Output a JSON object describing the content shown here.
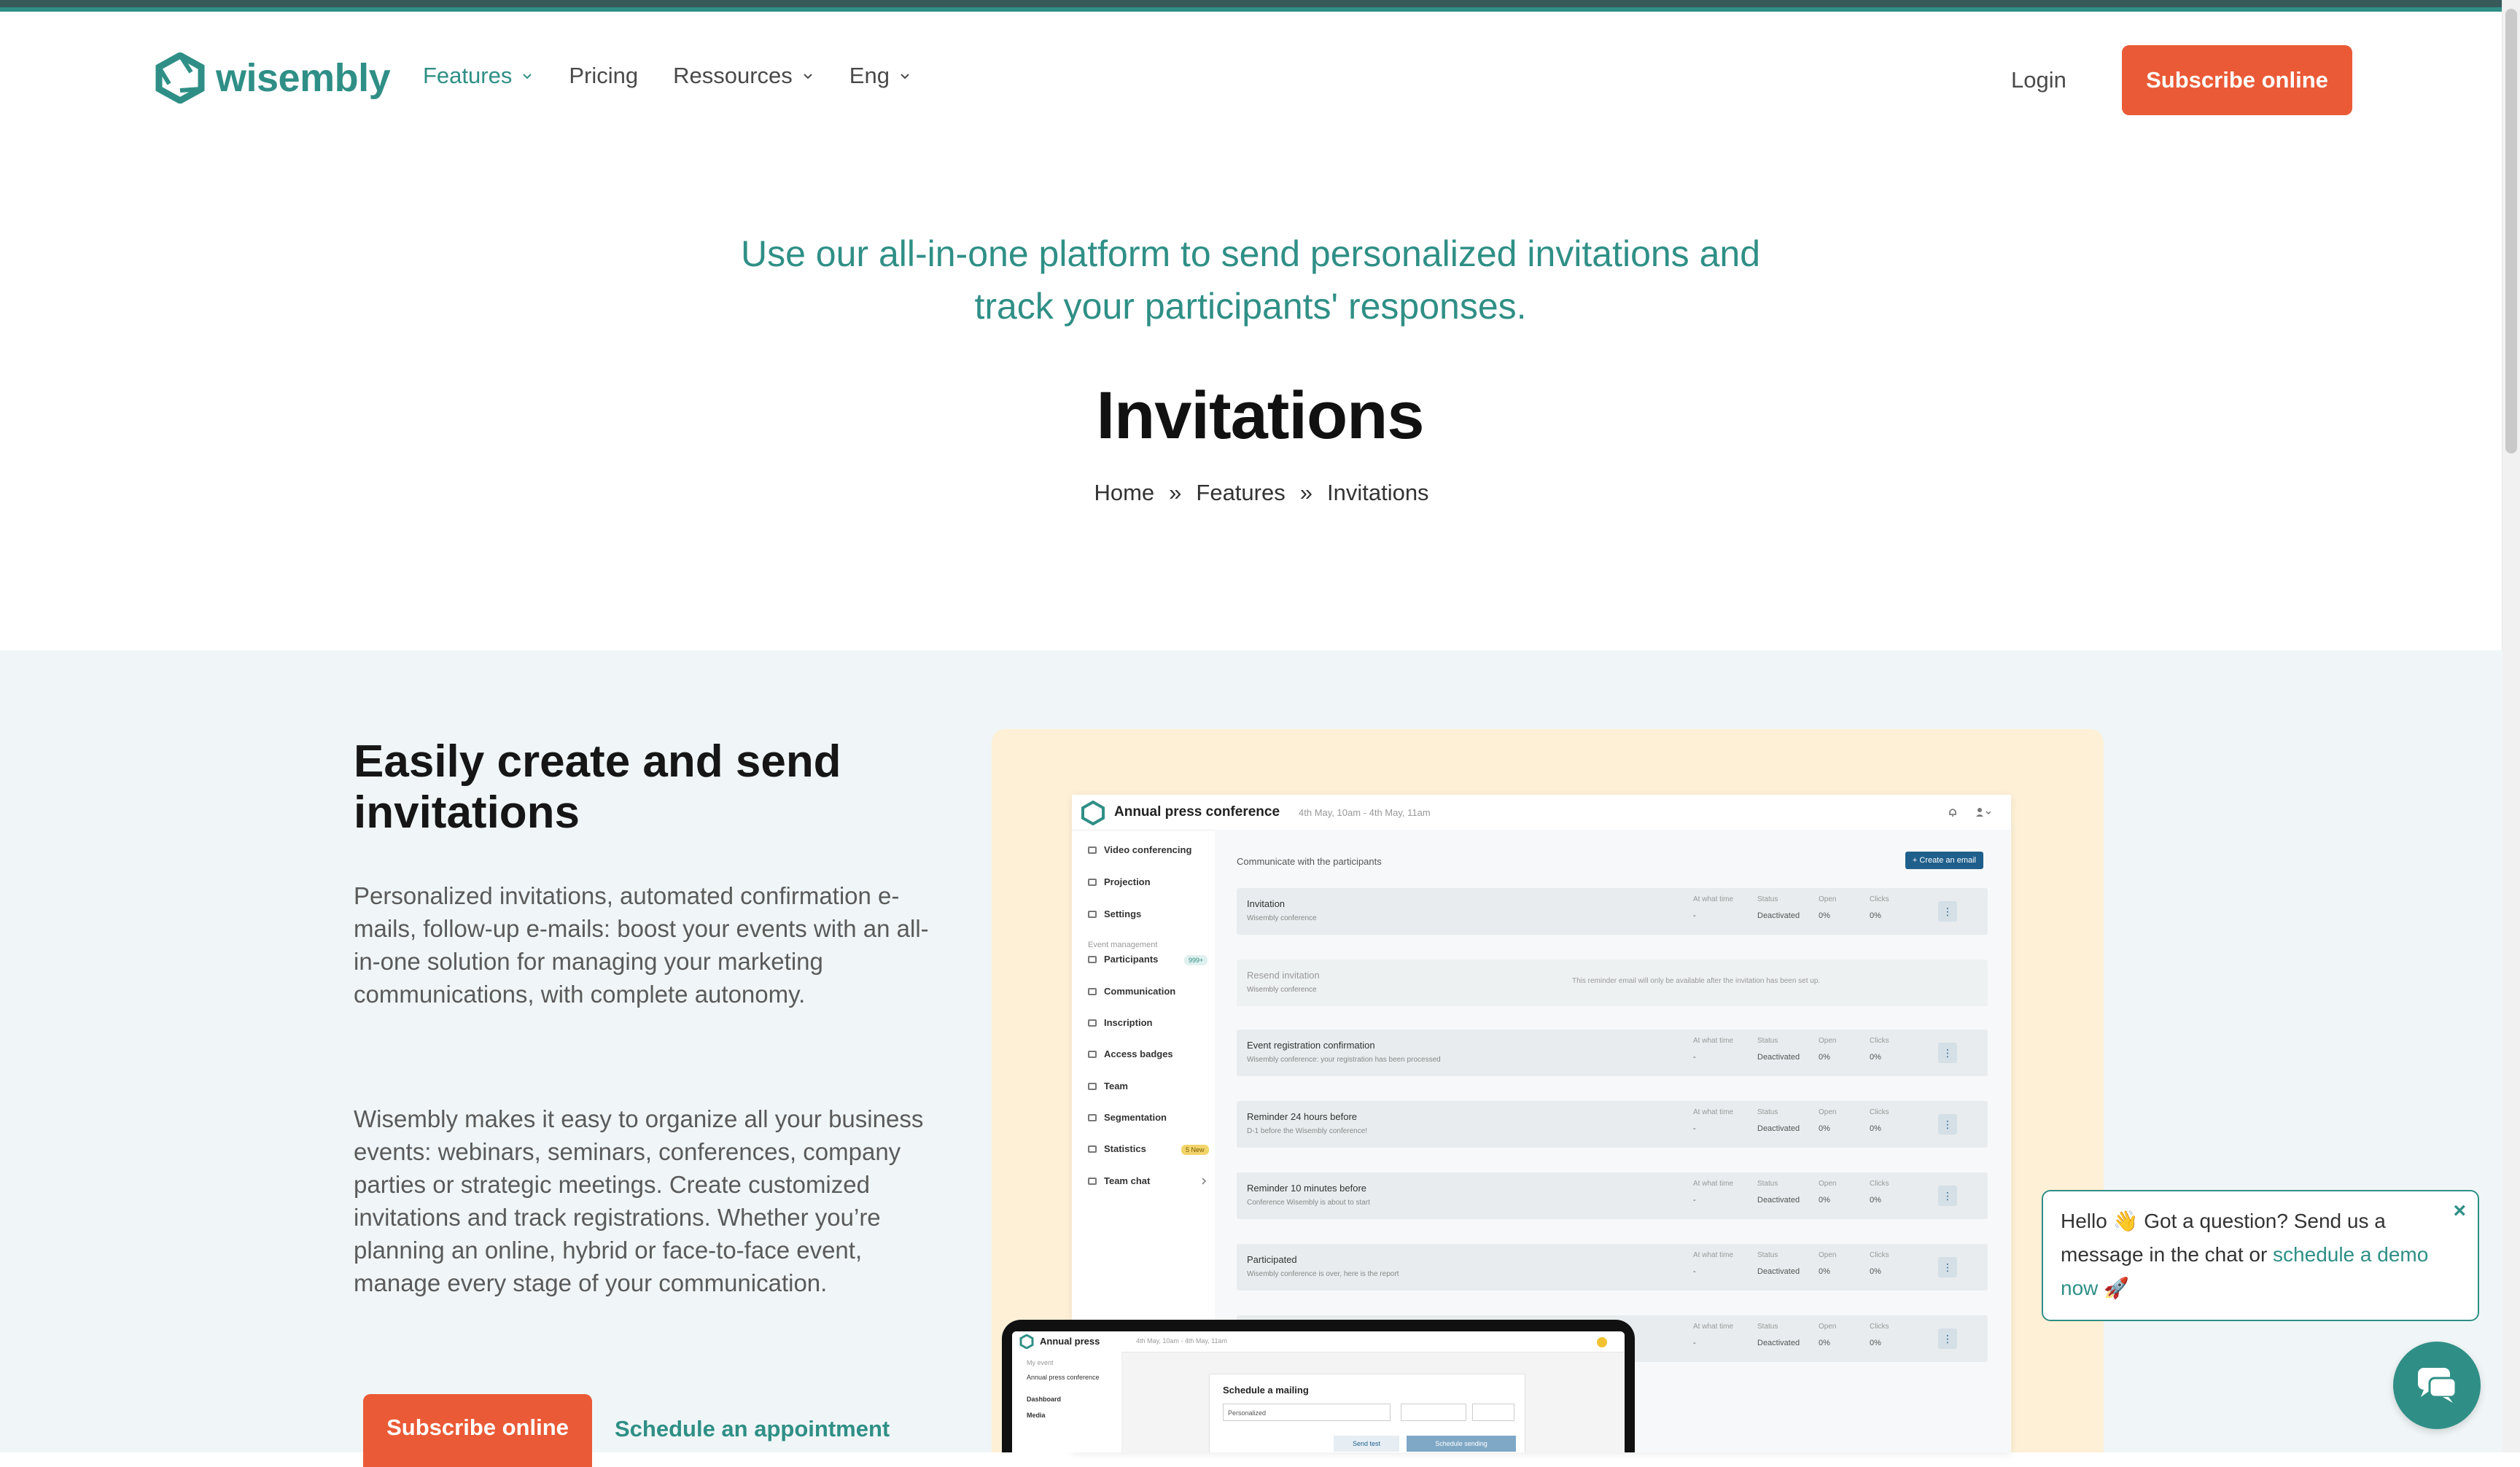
{
  "header": {
    "logo_text": "wisembly",
    "nav": [
      {
        "label": "Features",
        "has_dropdown": true,
        "active": true
      },
      {
        "label": "Pricing",
        "has_dropdown": false
      },
      {
        "label": "Ressources",
        "has_dropdown": true
      },
      {
        "label": "Eng",
        "has_dropdown": true
      }
    ],
    "login_label": "Login",
    "subscribe_label": "Subscribe online"
  },
  "hero": {
    "subtitle_line1": "Use our all-in-one platform to send personalized invitations and",
    "subtitle_line2": "track your participants' responses.",
    "title": "Invitations",
    "breadcrumb": [
      "Home",
      "Features",
      "Invitations"
    ],
    "breadcrumb_sep": "»"
  },
  "section": {
    "title": "Easily create and send invitations",
    "paragraph1": "Personalized invitations, automated confirmation e-mails, follow-up e-mails: boost your events with an all-in-one solution for managing your marketing communications, with complete autonomy.",
    "paragraph2": "Wisembly makes it easy to organize all your business events: webinars, seminars, conferences, company parties or strategic meetings. Create customized invitations and track registrations. Whether you’re planning an online, hybrid or face-to-face event, manage every stage of your communication.",
    "subscribe_label": "Subscribe online",
    "appointment_label": "Schedule an appointment"
  },
  "mockup": {
    "event_title": "Annual press conference",
    "event_date": "4th May, 10am - 4th May, 11am",
    "sidebar": {
      "items_top": [
        "Video conferencing",
        "Projection",
        "Settings"
      ],
      "section_label": "Event management",
      "items": [
        "Participants",
        "Communication",
        "Inscription",
        "Access badges",
        "Team",
        "Segmentation",
        "Statistics",
        "Team chat"
      ],
      "participants_badge": "999+",
      "statistics_badge": "5 New"
    },
    "main_title": "Communicate with the participants",
    "create_btn": "+ Create an email",
    "columns": [
      "At what time",
      "Status",
      "Open",
      "Clicks"
    ],
    "rows": [
      {
        "title": "Invitation",
        "sub": "Wisembly conference",
        "time": "-",
        "status": "Deactivated",
        "open": "0%",
        "clicks": "0%"
      },
      {
        "title": "Resend invitation",
        "sub": "Wisembly conference",
        "note": "This reminder email will only be available after the invitation has been set up."
      },
      {
        "title": "Event registration confirmation",
        "sub": "Wisembly conference: your registration has been processed",
        "time": "-",
        "status": "Deactivated",
        "open": "0%",
        "clicks": "0%"
      },
      {
        "title": "Reminder 24 hours before",
        "sub": "D-1 before the Wisembly conference!",
        "time": "-",
        "status": "Deactivated",
        "open": "0%",
        "clicks": "0%"
      },
      {
        "title": "Reminder 10 minutes before",
        "sub": "Conference Wisembly is about to start",
        "time": "-",
        "status": "Deactivated",
        "open": "0%",
        "clicks": "0%"
      },
      {
        "title": "Participated",
        "sub": "Wisembly conference is over, here is the report",
        "time": "-",
        "status": "Deactivated",
        "open": "0%",
        "clicks": "0%"
      },
      {
        "title": "",
        "sub": "",
        "time": "-",
        "status": "Deactivated",
        "open": "0%",
        "clicks": "0%"
      }
    ],
    "laptop": {
      "title": "Annual press",
      "date": "4th May, 10am - 4th May, 11am",
      "side_items": [
        "My event",
        "Annual press conference",
        "Dashboard",
        "Media"
      ],
      "card_title": "Schedule a mailing",
      "select_value": "Personalized",
      "btn_send_test": "Send test",
      "btn_schedule": "Schedule sending"
    }
  },
  "chat": {
    "text_before": "Hello 👋 Got a question? Send us a message in the chat or ",
    "link_text": "schedule a demo now",
    "text_after": " 🚀",
    "close_label": "×"
  },
  "colors": {
    "brand": "#2f8f86",
    "accent": "#ea5a36",
    "section_bg": "#f0f6f7",
    "mockup_bg": "#fdf0d6"
  }
}
